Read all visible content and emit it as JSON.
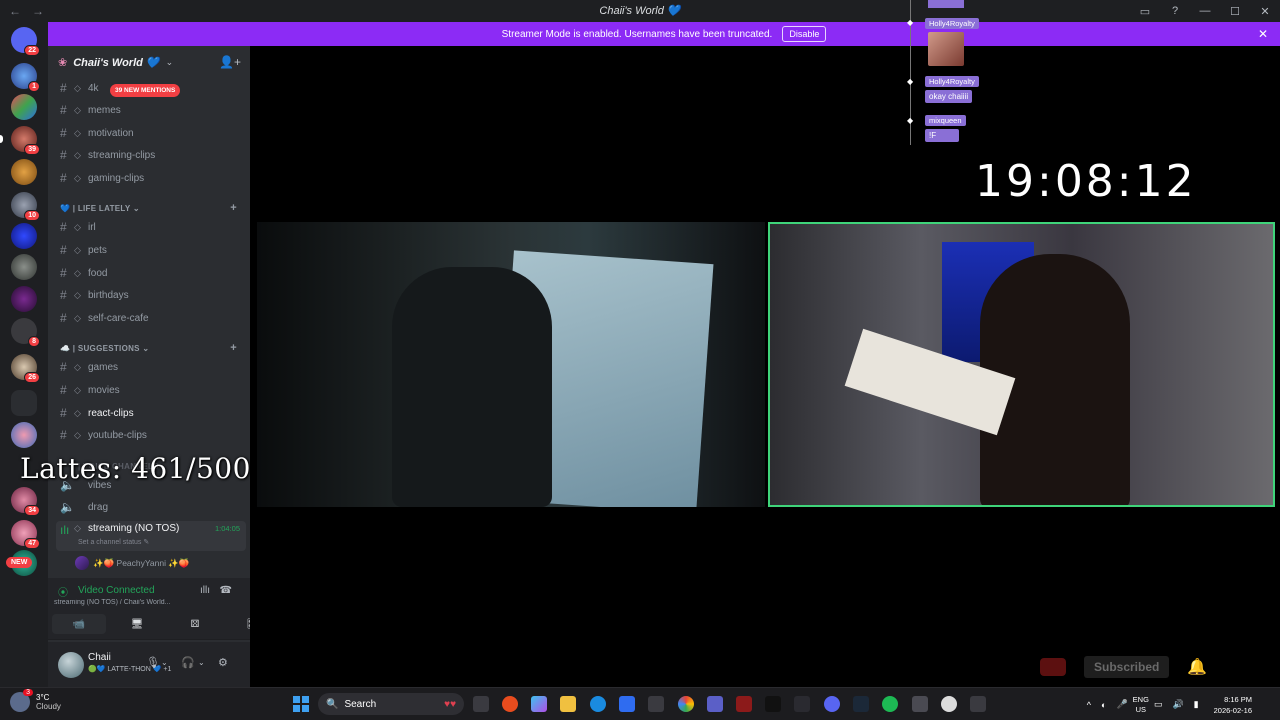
{
  "window": {
    "title": "Chaii's World 💙",
    "nav_back": "←",
    "nav_fwd": "→"
  },
  "titlebar_buttons": [
    {
      "name": "inbox-icon",
      "glyph": "▭"
    },
    {
      "name": "help-icon",
      "glyph": "?"
    },
    {
      "name": "minimize-icon",
      "glyph": "—"
    },
    {
      "name": "maximize-icon",
      "glyph": "☐"
    },
    {
      "name": "close-icon",
      "glyph": "✕"
    }
  ],
  "banner": {
    "message": "Streamer Mode is enabled. Usernames have been truncated.",
    "button": "Disable",
    "close": "✕"
  },
  "rail": {
    "badges": [
      "22",
      "1",
      "39",
      "10",
      "8",
      "26",
      "34",
      "47"
    ],
    "new_label": "NEW"
  },
  "guild": {
    "name": "Chaii's World 💙",
    "chevron": "⌄",
    "invite": "👤+"
  },
  "mentions_pill": "39 NEW MENTIONS",
  "channels": {
    "top": [
      "4k",
      "memes",
      "motivation",
      "streaming-clips",
      "gaming-clips"
    ],
    "cat_life": "💙 | LIFE LATELY ⌄",
    "life": [
      "irl",
      "pets",
      "food",
      "birthdays",
      "self-care-cafe"
    ],
    "cat_suggestions": "☁️ | SUGGESTIONS ⌄",
    "suggestions": [
      "games",
      "movies",
      "react-clips",
      "youtube-clips"
    ],
    "cat_voice": "| VOICE CHANNELS",
    "voice": [
      "vibes",
      "drag",
      "streaming (NO TOS)"
    ],
    "voice_timer": "1:04:05",
    "voice_status": "Set a channel status ✎",
    "voice_user": "✨🍑 PeachyYanni ✨🍑"
  },
  "overlay_lattes": "Lattes: 461/500",
  "connection": {
    "status": "Video Connected",
    "sub": "streaming (NO TOS) / Chaii's World...",
    "buttons": [
      "📹",
      "🖥",
      "⚄",
      "🎛"
    ]
  },
  "user": {
    "name": "Chaii",
    "status": "🟢💙 LATTE-THON 💙 +1"
  },
  "stream": {
    "clock": "19:08:12",
    "chat": [
      {
        "name": "Holly4Royalty",
        "msg": ""
      },
      {
        "name": "Holly4Royalty",
        "msg": "okay chaiiii"
      },
      {
        "name": "mixqueen",
        "msg": "!F"
      }
    ],
    "subscribed": "Subscribed"
  },
  "taskbar": {
    "weather_temp": "3°C",
    "weather_desc": "Cloudy",
    "weather_badge": "3",
    "search": "Search",
    "lang1": "ENG",
    "lang2": "US",
    "time": "8:16 PM",
    "date": "2026-02-16"
  },
  "colors": {
    "accent": "#8c2bf5",
    "connected": "#23a55a",
    "badge": "#f23f43",
    "cam_border": "#3fd47a"
  }
}
